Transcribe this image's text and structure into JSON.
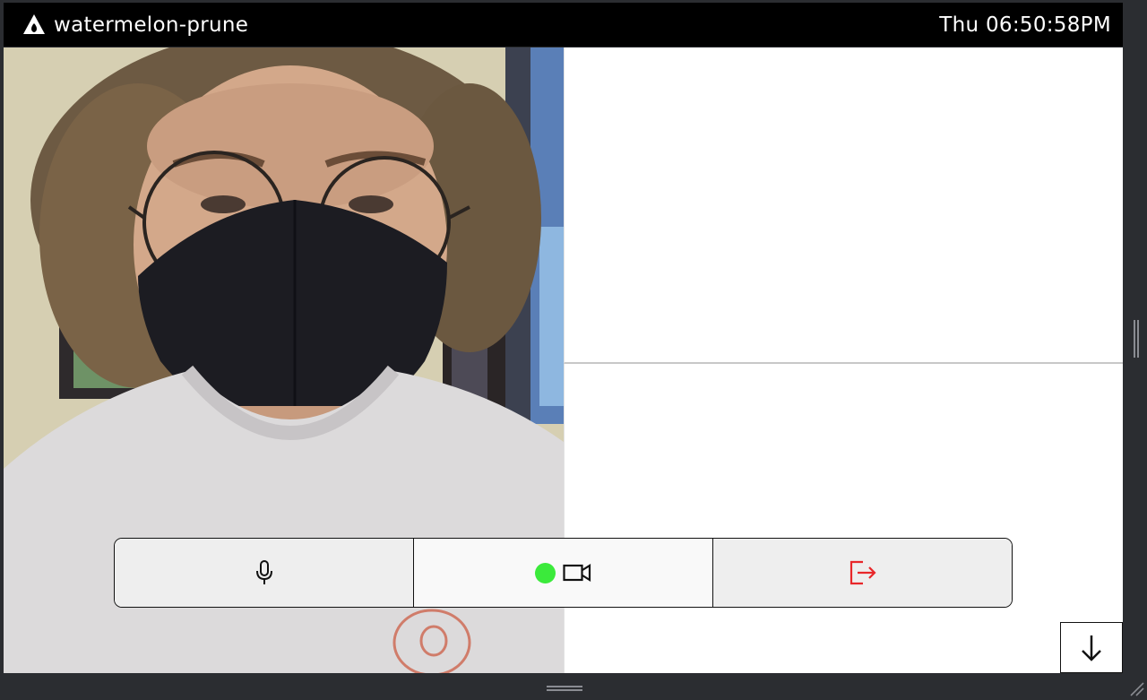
{
  "titlebar": {
    "app_title": "watermelon-prune",
    "clock": "Thu 06:50:58PM",
    "logo_icon": "watermelon-logo-icon"
  },
  "video": {
    "local_tile_content": "webcam-feed-person-with-glasses-and-mask"
  },
  "controls": {
    "mic_icon": "microphone-icon",
    "camera_icon": "video-camera-icon",
    "camera_status_color": "#3bea3b",
    "leave_icon": "leave-call-icon",
    "leave_color": "#e8272a"
  },
  "scroll_button": {
    "icon": "arrow-down-icon"
  },
  "colors": {
    "titlebar_bg": "#000000",
    "frame_bg": "#2b2d31",
    "content_bg": "#ffffff"
  }
}
